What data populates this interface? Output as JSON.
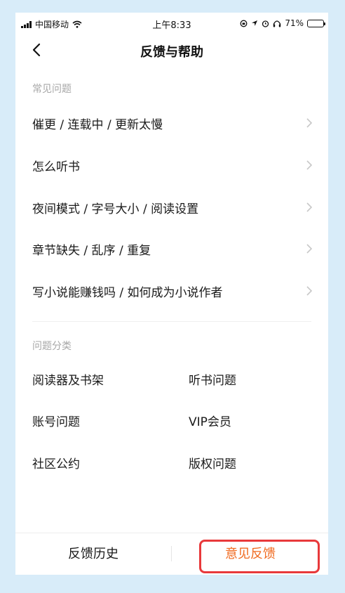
{
  "status_bar": {
    "carrier": "中国移动",
    "time": "上午8:33",
    "battery": "71%",
    "battery_level": 0.71
  },
  "header": {
    "title": "反馈与帮助"
  },
  "faq": {
    "section_label": "常见问题",
    "items": [
      {
        "label": "催更 / 连载中 / 更新太慢"
      },
      {
        "label": "怎么听书"
      },
      {
        "label": "夜间模式 / 字号大小 / 阅读设置"
      },
      {
        "label": "章节缺失 / 乱序 / 重复"
      },
      {
        "label": "写小说能赚钱吗 / 如何成为小说作者"
      }
    ]
  },
  "categories": {
    "section_label": "问题分类",
    "items": [
      {
        "label": "阅读器及书架"
      },
      {
        "label": "听书问题"
      },
      {
        "label": "账号问题"
      },
      {
        "label": "VIP会员"
      },
      {
        "label": "社区公约"
      },
      {
        "label": "版权问题"
      }
    ]
  },
  "bottom_bar": {
    "history_label": "反馈历史",
    "feedback_label": "意见反馈"
  },
  "colors": {
    "accent": "#f06a1f",
    "highlight": "#e8393b",
    "background": "#d8ecf9"
  }
}
